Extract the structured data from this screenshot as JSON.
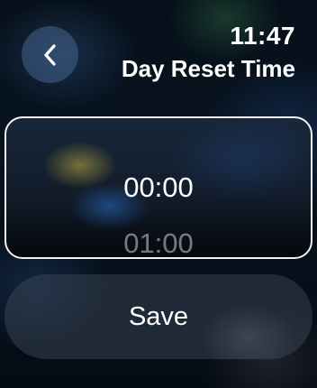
{
  "header": {
    "time": "11:47",
    "title": "Day Reset Time",
    "back_icon": "chevron-left-icon"
  },
  "picker": {
    "selected": "00:00",
    "next": "01:00"
  },
  "actions": {
    "save_label": "Save"
  },
  "colors": {
    "background": "#07131f",
    "picker_border": "#f2f2f2",
    "button_fill": "#374150"
  }
}
